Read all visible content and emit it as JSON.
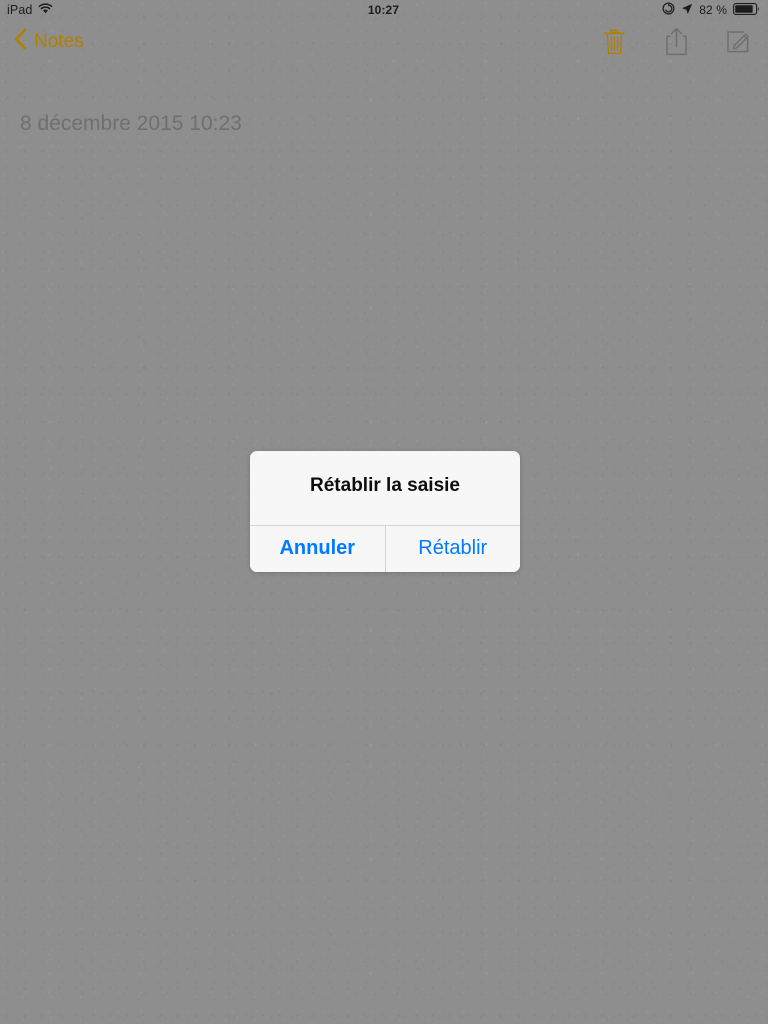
{
  "status_bar": {
    "carrier": "iPad",
    "wifi_icon": "wifi-icon",
    "time": "10:27",
    "rotation_lock_icon": "rotation-lock-icon",
    "location_icon": "location-arrow-icon",
    "battery_percent": "82 %",
    "battery_icon": "battery-icon",
    "battery_level": 82
  },
  "nav_bar": {
    "back_icon": "chevron-left-icon",
    "back_label": "Notes",
    "actions": [
      {
        "name": "trash-button",
        "icon": "trash-icon",
        "enabled": true
      },
      {
        "name": "share-button",
        "icon": "share-icon",
        "enabled": false
      },
      {
        "name": "compose-button",
        "icon": "compose-icon",
        "enabled": false
      }
    ]
  },
  "note": {
    "date": "8 décembre 2015 10:23",
    "body": ""
  },
  "alert": {
    "title": "Rétablir la saisie",
    "message": "",
    "cancel_label": "Annuler",
    "confirm_label": "Rétablir"
  },
  "colors": {
    "accent_amber": "#b08000",
    "accent_blue": "#007aff",
    "dimmed_background": "#8e8e8e",
    "alert_background": "#f7f7f7",
    "disabled_gray": "#6e6e6e"
  }
}
